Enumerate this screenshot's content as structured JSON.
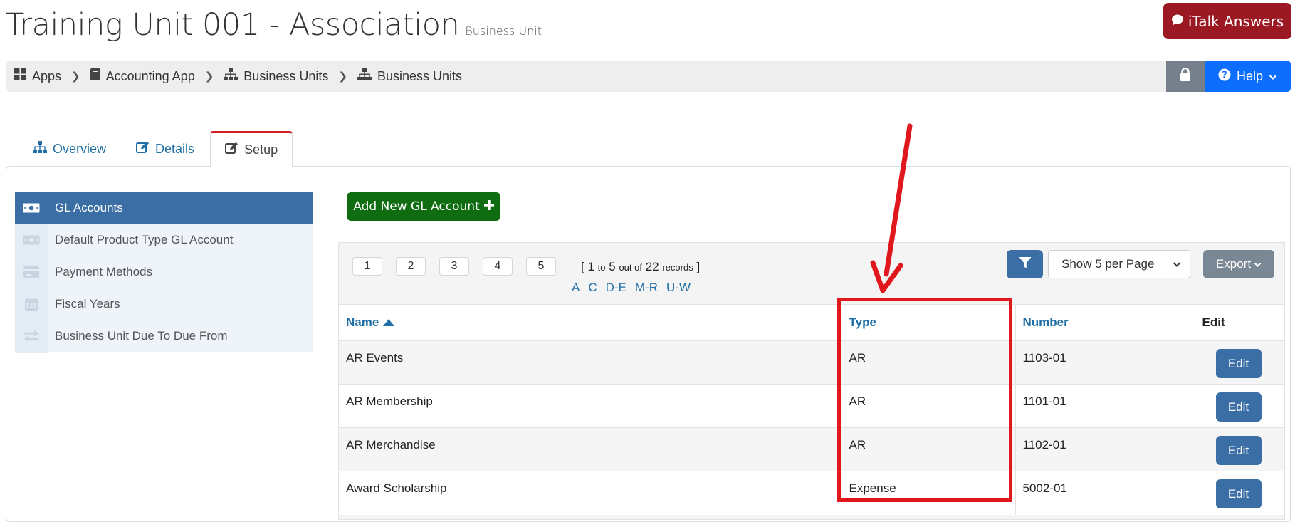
{
  "header": {
    "title": "Training Unit 001 - Association",
    "subtitle": "Business Unit",
    "italk_label": "iTalk Answers"
  },
  "breadcrumb": [
    {
      "label": "Apps",
      "icon": "grid-icon"
    },
    {
      "label": "Accounting App",
      "icon": "book-icon"
    },
    {
      "label": "Business Units",
      "icon": "sitemap-icon"
    },
    {
      "label": "Business Units",
      "icon": "sitemap-icon"
    }
  ],
  "help_label": "Help",
  "tabs": [
    {
      "label": "Overview",
      "icon": "sitemap-icon",
      "active": false
    },
    {
      "label": "Details",
      "icon": "edit-icon",
      "active": false
    },
    {
      "label": "Setup",
      "icon": "edit-icon",
      "active": true
    }
  ],
  "side_menu": [
    {
      "label": "GL Accounts",
      "icon": "money-icon",
      "active": true
    },
    {
      "label": "Default Product Type GL Account",
      "icon": "money-icon",
      "active": false
    },
    {
      "label": "Payment Methods",
      "icon": "credit-card-icon",
      "active": false
    },
    {
      "label": "Fiscal Years",
      "icon": "calendar-icon",
      "active": false
    },
    {
      "label": "Business Unit Due To Due From",
      "icon": "exchange-icon",
      "active": false
    }
  ],
  "add_button_label": "Add New GL Account",
  "pagination": {
    "pages": [
      "1",
      "2",
      "3",
      "4",
      "5"
    ],
    "records": {
      "open": "[",
      "from": "1",
      "to_word": "to",
      "to": "5",
      "out_of": "out of",
      "total": "22",
      "word": "records",
      "close": "]"
    },
    "letters": [
      "A",
      "C",
      "D-E",
      "M-R",
      "U-W"
    ]
  },
  "per_page_label": "Show 5 per Page",
  "export_label": "Export",
  "table": {
    "columns": [
      "Name",
      "Type",
      "Number",
      "Edit"
    ],
    "edit_label": "Edit",
    "rows": [
      {
        "name": "AR Events",
        "type": "AR",
        "number": "1103-01"
      },
      {
        "name": "AR Membership",
        "type": "AR",
        "number": "1101-01"
      },
      {
        "name": "AR Merchandise",
        "type": "AR",
        "number": "1102-01"
      },
      {
        "name": "Award Scholarship",
        "type": "Expense",
        "number": "5002-01"
      }
    ]
  },
  "annotation": {
    "color": "#e0171d"
  },
  "colors": {
    "brand_red": "#9b1922",
    "primary_blue": "#0d6efd",
    "link_blue": "#1f6fa6",
    "active_menu": "#3a6ea5",
    "add_green": "#0f6c10"
  }
}
